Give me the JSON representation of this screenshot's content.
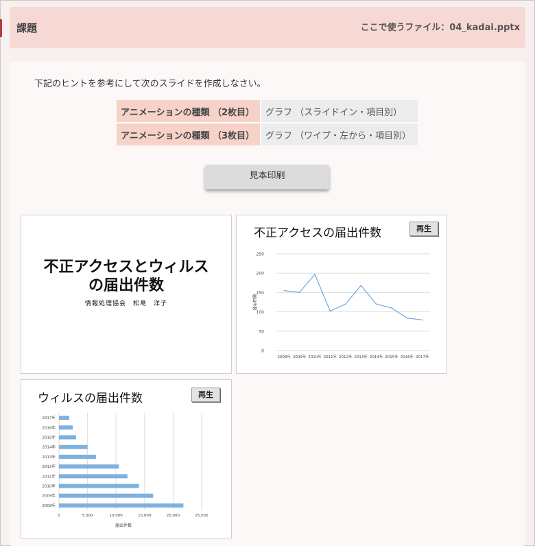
{
  "header": {
    "title": "課題",
    "file_label": "ここで使うファイル：04_kadai.pptx"
  },
  "instruction": "下記のヒントを参考にして次のスライドを作成しなさい。",
  "hints": [
    {
      "key": "アニメーションの種類 （2枚目）",
      "value": "グラフ （スライドイン・項目別）"
    },
    {
      "key": "アニメーションの種類 （3枚目）",
      "value": "グラフ （ワイプ・左から・項目別）"
    }
  ],
  "print_button": "見本印刷",
  "slide1": {
    "title_line1": "不正アクセスとウィルス",
    "title_line2": "の届出件数",
    "subtitle": "情報処理協会　松島　洋子"
  },
  "slide2": {
    "title": "不正アクセスの届出件数",
    "play_label": "再生"
  },
  "slide3": {
    "title": "ウィルスの届出件数",
    "play_label": "再生"
  },
  "chart_data": [
    {
      "type": "line",
      "title": "不正アクセスの届出件数",
      "ylabel": "届出件数",
      "categories": [
        "2008年",
        "2009年",
        "2010年",
        "2011年",
        "2012年",
        "2013年",
        "2014年",
        "2015年",
        "2016年",
        "2017年"
      ],
      "values": [
        155,
        150,
        197,
        102,
        120,
        168,
        120,
        110,
        84,
        79
      ],
      "ylim": [
        0,
        250
      ],
      "yticks": [
        "0",
        "50",
        "100",
        "150",
        "200",
        "250"
      ],
      "color": "#6fa8dc",
      "grid": true
    },
    {
      "type": "bar",
      "orientation": "horizontal",
      "title": "ウィルスの届出件数",
      "xlabel": "届出件数",
      "categories": [
        "2017年",
        "2016年",
        "2015年",
        "2014年",
        "2013年",
        "2012年",
        "2011年",
        "2010年",
        "2009年",
        "2008年"
      ],
      "values": [
        1800,
        2400,
        3000,
        5000,
        6500,
        10500,
        12000,
        14000,
        16500,
        21800
      ],
      "xlim": [
        0,
        25000
      ],
      "xticks": [
        "0",
        "5,000",
        "10,000",
        "15,000",
        "20,000",
        "25,000"
      ],
      "color": "#7fb0de",
      "grid": true
    }
  ]
}
